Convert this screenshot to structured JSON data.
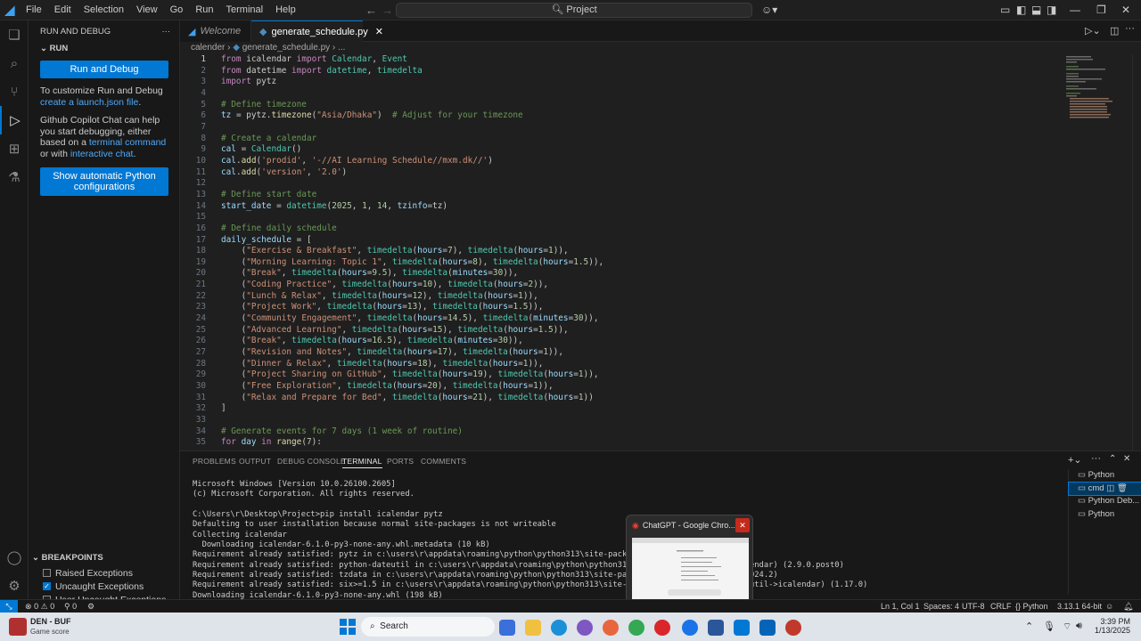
{
  "menu": [
    "File",
    "Edit",
    "Selection",
    "View",
    "Go",
    "Run",
    "Terminal",
    "Help"
  ],
  "command_center": "Project",
  "sidebar": {
    "title": "RUN AND DEBUG",
    "section": "RUN",
    "run_button": "Run and Debug",
    "customize_text": "To customize Run and Debug ",
    "customize_link": "create a launch.json file",
    "customize_end": ".",
    "copilot_text": "Github Copilot Chat can help you start debugging, either based on a ",
    "copilot_link1": "terminal command",
    "copilot_mid": " or with ",
    "copilot_link2": "interactive chat",
    "copilot_end": ".",
    "python_button": "Show automatic Python configurations",
    "breakpoints_title": "BREAKPOINTS",
    "breakpoints": [
      {
        "label": "Raised Exceptions",
        "checked": false
      },
      {
        "label": "Uncaught Exceptions",
        "checked": true
      },
      {
        "label": "User Uncaught Exceptions",
        "checked": false
      }
    ]
  },
  "tabs": [
    {
      "label": "Welcome",
      "active": false
    },
    {
      "label": "generate_schedule.py",
      "active": true
    }
  ],
  "breadcrumb": [
    "calender",
    "generate_schedule.py",
    "..."
  ],
  "code_lines": [
    [
      [
        "kw",
        "from"
      ],
      [
        "t",
        " icalendar "
      ],
      [
        "kw",
        "import"
      ],
      [
        "cls",
        " Calendar"
      ],
      [
        "t",
        ", "
      ],
      [
        "cls",
        "Event"
      ]
    ],
    [
      [
        "kw",
        "from"
      ],
      [
        "t",
        " datetime "
      ],
      [
        "kw",
        "import"
      ],
      [
        "cls",
        " datetime"
      ],
      [
        "t",
        ", "
      ],
      [
        "cls",
        "timedelta"
      ]
    ],
    [
      [
        "kw",
        "import"
      ],
      [
        "t",
        " pytz"
      ]
    ],
    [],
    [
      [
        "cmt",
        "# Define timezone"
      ]
    ],
    [
      [
        "var",
        "tz"
      ],
      [
        "t",
        " = pytz."
      ],
      [
        "fn",
        "timezone"
      ],
      [
        "t",
        "("
      ],
      [
        "str",
        "\"Asia/Dhaka\""
      ],
      [
        "t",
        ")  "
      ],
      [
        "cmt",
        "# Adjust for your timezone"
      ]
    ],
    [],
    [
      [
        "cmt",
        "# Create a calendar"
      ]
    ],
    [
      [
        "var",
        "cal"
      ],
      [
        "t",
        " = "
      ],
      [
        "cls",
        "Calendar"
      ],
      [
        "t",
        "()"
      ]
    ],
    [
      [
        "var",
        "cal"
      ],
      [
        "t",
        "."
      ],
      [
        "fn",
        "add"
      ],
      [
        "t",
        "("
      ],
      [
        "str",
        "'prodid'"
      ],
      [
        "t",
        ", "
      ],
      [
        "str",
        "'-//AI Learning Schedule//mxm.dk//'"
      ],
      [
        "t",
        ")"
      ]
    ],
    [
      [
        "var",
        "cal"
      ],
      [
        "t",
        "."
      ],
      [
        "fn",
        "add"
      ],
      [
        "t",
        "("
      ],
      [
        "str",
        "'version'"
      ],
      [
        "t",
        ", "
      ],
      [
        "str",
        "'2.0'"
      ],
      [
        "t",
        ")"
      ]
    ],
    [],
    [
      [
        "cmt",
        "# Define start date"
      ]
    ],
    [
      [
        "var",
        "start_date"
      ],
      [
        "t",
        " = "
      ],
      [
        "cls",
        "datetime"
      ],
      [
        "t",
        "("
      ],
      [
        "num",
        "2025"
      ],
      [
        "t",
        ", "
      ],
      [
        "num",
        "1"
      ],
      [
        "t",
        ", "
      ],
      [
        "num",
        "14"
      ],
      [
        "t",
        ", "
      ],
      [
        "var",
        "tzinfo"
      ],
      [
        "t",
        "=tz)"
      ]
    ],
    [],
    [
      [
        "cmt",
        "# Define daily schedule"
      ]
    ],
    [
      [
        "var",
        "daily_schedule"
      ],
      [
        "t",
        " = ["
      ]
    ],
    [
      [
        "t",
        "    ("
      ],
      [
        "str",
        "\"Exercise & Breakfast\""
      ],
      [
        "t",
        ", "
      ],
      [
        "cls",
        "timedelta"
      ],
      [
        "t",
        "("
      ],
      [
        "var",
        "hours"
      ],
      [
        "t",
        "="
      ],
      [
        "num",
        "7"
      ],
      [
        "t",
        "), "
      ],
      [
        "cls",
        "timedelta"
      ],
      [
        "t",
        "("
      ],
      [
        "var",
        "hours"
      ],
      [
        "t",
        "="
      ],
      [
        "num",
        "1"
      ],
      [
        "t",
        ")),"
      ]
    ],
    [
      [
        "t",
        "    ("
      ],
      [
        "str",
        "\"Morning Learning: Topic 1\""
      ],
      [
        "t",
        ", "
      ],
      [
        "cls",
        "timedelta"
      ],
      [
        "t",
        "("
      ],
      [
        "var",
        "hours"
      ],
      [
        "t",
        "="
      ],
      [
        "num",
        "8"
      ],
      [
        "t",
        "), "
      ],
      [
        "cls",
        "timedelta"
      ],
      [
        "t",
        "("
      ],
      [
        "var",
        "hours"
      ],
      [
        "t",
        "="
      ],
      [
        "num",
        "1.5"
      ],
      [
        "t",
        ")),"
      ]
    ],
    [
      [
        "t",
        "    ("
      ],
      [
        "str",
        "\"Break\""
      ],
      [
        "t",
        ", "
      ],
      [
        "cls",
        "timedelta"
      ],
      [
        "t",
        "("
      ],
      [
        "var",
        "hours"
      ],
      [
        "t",
        "="
      ],
      [
        "num",
        "9.5"
      ],
      [
        "t",
        "), "
      ],
      [
        "cls",
        "timedelta"
      ],
      [
        "t",
        "("
      ],
      [
        "var",
        "minutes"
      ],
      [
        "t",
        "="
      ],
      [
        "num",
        "30"
      ],
      [
        "t",
        ")),"
      ]
    ],
    [
      [
        "t",
        "    ("
      ],
      [
        "str",
        "\"Coding Practice\""
      ],
      [
        "t",
        ", "
      ],
      [
        "cls",
        "timedelta"
      ],
      [
        "t",
        "("
      ],
      [
        "var",
        "hours"
      ],
      [
        "t",
        "="
      ],
      [
        "num",
        "10"
      ],
      [
        "t",
        "), "
      ],
      [
        "cls",
        "timedelta"
      ],
      [
        "t",
        "("
      ],
      [
        "var",
        "hours"
      ],
      [
        "t",
        "="
      ],
      [
        "num",
        "2"
      ],
      [
        "t",
        ")),"
      ]
    ],
    [
      [
        "t",
        "    ("
      ],
      [
        "str",
        "\"Lunch & Relax\""
      ],
      [
        "t",
        ", "
      ],
      [
        "cls",
        "timedelta"
      ],
      [
        "t",
        "("
      ],
      [
        "var",
        "hours"
      ],
      [
        "t",
        "="
      ],
      [
        "num",
        "12"
      ],
      [
        "t",
        "), "
      ],
      [
        "cls",
        "timedelta"
      ],
      [
        "t",
        "("
      ],
      [
        "var",
        "hours"
      ],
      [
        "t",
        "="
      ],
      [
        "num",
        "1"
      ],
      [
        "t",
        ")),"
      ]
    ],
    [
      [
        "t",
        "    ("
      ],
      [
        "str",
        "\"Project Work\""
      ],
      [
        "t",
        ", "
      ],
      [
        "cls",
        "timedelta"
      ],
      [
        "t",
        "("
      ],
      [
        "var",
        "hours"
      ],
      [
        "t",
        "="
      ],
      [
        "num",
        "13"
      ],
      [
        "t",
        "), "
      ],
      [
        "cls",
        "timedelta"
      ],
      [
        "t",
        "("
      ],
      [
        "var",
        "hours"
      ],
      [
        "t",
        "="
      ],
      [
        "num",
        "1.5"
      ],
      [
        "t",
        ")),"
      ]
    ],
    [
      [
        "t",
        "    ("
      ],
      [
        "str",
        "\"Community Engagement\""
      ],
      [
        "t",
        ", "
      ],
      [
        "cls",
        "timedelta"
      ],
      [
        "t",
        "("
      ],
      [
        "var",
        "hours"
      ],
      [
        "t",
        "="
      ],
      [
        "num",
        "14.5"
      ],
      [
        "t",
        "), "
      ],
      [
        "cls",
        "timedelta"
      ],
      [
        "t",
        "("
      ],
      [
        "var",
        "minutes"
      ],
      [
        "t",
        "="
      ],
      [
        "num",
        "30"
      ],
      [
        "t",
        ")),"
      ]
    ],
    [
      [
        "t",
        "    ("
      ],
      [
        "str",
        "\"Advanced Learning\""
      ],
      [
        "t",
        ", "
      ],
      [
        "cls",
        "timedelta"
      ],
      [
        "t",
        "("
      ],
      [
        "var",
        "hours"
      ],
      [
        "t",
        "="
      ],
      [
        "num",
        "15"
      ],
      [
        "t",
        "), "
      ],
      [
        "cls",
        "timedelta"
      ],
      [
        "t",
        "("
      ],
      [
        "var",
        "hours"
      ],
      [
        "t",
        "="
      ],
      [
        "num",
        "1.5"
      ],
      [
        "t",
        ")),"
      ]
    ],
    [
      [
        "t",
        "    ("
      ],
      [
        "str",
        "\"Break\""
      ],
      [
        "t",
        ", "
      ],
      [
        "cls",
        "timedelta"
      ],
      [
        "t",
        "("
      ],
      [
        "var",
        "hours"
      ],
      [
        "t",
        "="
      ],
      [
        "num",
        "16.5"
      ],
      [
        "t",
        "), "
      ],
      [
        "cls",
        "timedelta"
      ],
      [
        "t",
        "("
      ],
      [
        "var",
        "minutes"
      ],
      [
        "t",
        "="
      ],
      [
        "num",
        "30"
      ],
      [
        "t",
        ")),"
      ]
    ],
    [
      [
        "t",
        "    ("
      ],
      [
        "str",
        "\"Revision and Notes\""
      ],
      [
        "t",
        ", "
      ],
      [
        "cls",
        "timedelta"
      ],
      [
        "t",
        "("
      ],
      [
        "var",
        "hours"
      ],
      [
        "t",
        "="
      ],
      [
        "num",
        "17"
      ],
      [
        "t",
        "), "
      ],
      [
        "cls",
        "timedelta"
      ],
      [
        "t",
        "("
      ],
      [
        "var",
        "hours"
      ],
      [
        "t",
        "="
      ],
      [
        "num",
        "1"
      ],
      [
        "t",
        ")),"
      ]
    ],
    [
      [
        "t",
        "    ("
      ],
      [
        "str",
        "\"Dinner & Relax\""
      ],
      [
        "t",
        ", "
      ],
      [
        "cls",
        "timedelta"
      ],
      [
        "t",
        "("
      ],
      [
        "var",
        "hours"
      ],
      [
        "t",
        "="
      ],
      [
        "num",
        "18"
      ],
      [
        "t",
        "), "
      ],
      [
        "cls",
        "timedelta"
      ],
      [
        "t",
        "("
      ],
      [
        "var",
        "hours"
      ],
      [
        "t",
        "="
      ],
      [
        "num",
        "1"
      ],
      [
        "t",
        ")),"
      ]
    ],
    [
      [
        "t",
        "    ("
      ],
      [
        "str",
        "\"Project Sharing on GitHub\""
      ],
      [
        "t",
        ", "
      ],
      [
        "cls",
        "timedelta"
      ],
      [
        "t",
        "("
      ],
      [
        "var",
        "hours"
      ],
      [
        "t",
        "="
      ],
      [
        "num",
        "19"
      ],
      [
        "t",
        "), "
      ],
      [
        "cls",
        "timedelta"
      ],
      [
        "t",
        "("
      ],
      [
        "var",
        "hours"
      ],
      [
        "t",
        "="
      ],
      [
        "num",
        "1"
      ],
      [
        "t",
        ")),"
      ]
    ],
    [
      [
        "t",
        "    ("
      ],
      [
        "str",
        "\"Free Exploration\""
      ],
      [
        "t",
        ", "
      ],
      [
        "cls",
        "timedelta"
      ],
      [
        "t",
        "("
      ],
      [
        "var",
        "hours"
      ],
      [
        "t",
        "="
      ],
      [
        "num",
        "20"
      ],
      [
        "t",
        "), "
      ],
      [
        "cls",
        "timedelta"
      ],
      [
        "t",
        "("
      ],
      [
        "var",
        "hours"
      ],
      [
        "t",
        "="
      ],
      [
        "num",
        "1"
      ],
      [
        "t",
        ")),"
      ]
    ],
    [
      [
        "t",
        "    ("
      ],
      [
        "str",
        "\"Relax and Prepare for Bed\""
      ],
      [
        "t",
        ", "
      ],
      [
        "cls",
        "timedelta"
      ],
      [
        "t",
        "("
      ],
      [
        "var",
        "hours"
      ],
      [
        "t",
        "="
      ],
      [
        "num",
        "21"
      ],
      [
        "t",
        "), "
      ],
      [
        "cls",
        "timedelta"
      ],
      [
        "t",
        "("
      ],
      [
        "var",
        "hours"
      ],
      [
        "t",
        "="
      ],
      [
        "num",
        "1"
      ],
      [
        "t",
        "))"
      ]
    ],
    [
      [
        "t",
        "]"
      ]
    ],
    [],
    [
      [
        "cmt",
        "# Generate events for 7 days (1 week of routine)"
      ]
    ],
    [
      [
        "kw",
        "for"
      ],
      [
        "var",
        " day"
      ],
      [
        "kw",
        " in"
      ],
      [
        "fn",
        " range"
      ],
      [
        "t",
        "("
      ],
      [
        "num",
        "7"
      ],
      [
        "t",
        "):"
      ]
    ]
  ],
  "current_line": 1,
  "panel_tabs": [
    {
      "label": "PROBLEMS",
      "active": false
    },
    {
      "label": "OUTPUT",
      "active": false
    },
    {
      "label": "DEBUG CONSOLE",
      "active": false
    },
    {
      "label": "TERMINAL",
      "active": true
    },
    {
      "label": "PORTS",
      "active": false
    },
    {
      "label": "COMMENTS",
      "active": false
    }
  ],
  "terminal_lines": [
    "Microsoft Windows [Version 10.0.26100.2605]",
    "(c) Microsoft Corporation. All rights reserved.",
    "",
    "C:\\Users\\r\\Desktop\\Project>pip install icalendar pytz",
    "Defaulting to user installation because normal site-packages is not writeable",
    "Collecting icalendar",
    "  Downloading icalendar-6.1.0-py3-none-any.whl.metadata (10 kB)",
    "Requirement already satisfied: pytz in c:\\users\\r\\appdata\\roaming\\python\\python313\\site-packages (2024.2)",
    "Requirement already satisfied: python-dateutil in c:\\users\\r\\appdata\\roaming\\python\\python313\\site-packages (from icalendar) (2.9.0.post0)",
    "Requirement already satisfied: tzdata in c:\\users\\r\\appdata\\roaming\\python\\python313\\site-packages (from icalendar) (2024.2)",
    "Requirement already satisfied: six>=1.5 in c:\\users\\r\\appdata\\roaming\\python\\python313\\site-packages (from python-dateutil->icalendar) (1.17.0)",
    "Downloading icalendar-6.1.0-py3-none-any.whl (198 kB)"
  ],
  "terminal_list": [
    {
      "label": "Python",
      "active": false
    },
    {
      "label": "cmd",
      "active": true
    },
    {
      "label": "Python Deb...",
      "active": false
    },
    {
      "label": "Python",
      "active": false
    }
  ],
  "preview_title": "ChatGPT - Google Chro...",
  "status": {
    "errors": "0",
    "warnings": "0",
    "ports": "0",
    "position": "Ln 1, Col 1",
    "spaces": "Spaces: 4",
    "encoding": "UTF-8",
    "eol": "CRLF",
    "language": "Python",
    "interpreter": "3.13.1 64-bit"
  },
  "taskbar": {
    "game_title": "DEN - BUF",
    "game_sub": "Game score",
    "search": "Search",
    "time": "3:39 PM",
    "date": "1/13/2025"
  },
  "colors": {
    "accent": "#0078d4",
    "bg": "#1f1f1f",
    "sidebar": "#181818"
  }
}
